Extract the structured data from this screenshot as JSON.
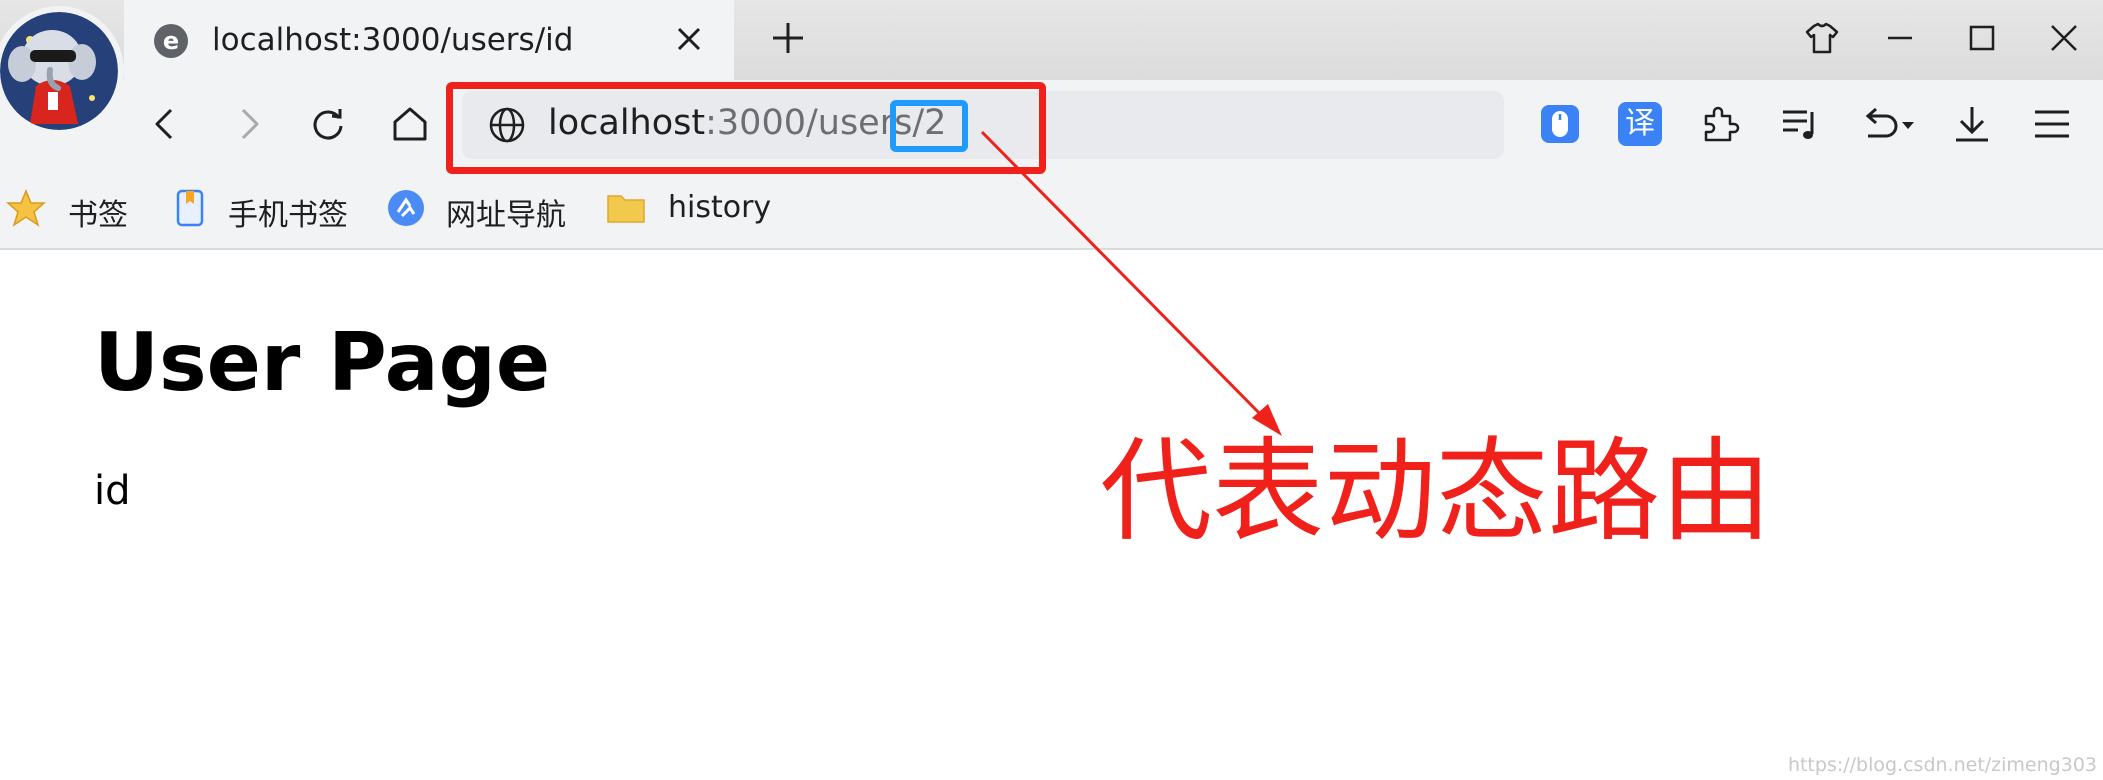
{
  "tab": {
    "favicon_glyph": "e",
    "title": "localhost:3000/users/id"
  },
  "omnibox": {
    "url_host": "localhost",
    "url_rest": ":3000/users/2"
  },
  "bookmarks": [
    {
      "icon": "star-icon",
      "label": "书签"
    },
    {
      "icon": "mobile-bookmark-icon",
      "label": "手机书签"
    },
    {
      "icon": "web-nav-icon",
      "label": "网址导航"
    },
    {
      "icon": "folder-icon",
      "label": "history"
    }
  ],
  "extensions": {
    "translate_glyph": "译"
  },
  "content": {
    "heading": "User Page",
    "text": "id"
  },
  "annotation": {
    "text": "代表动态路由",
    "color": "#f0201a",
    "highlight_color": "#1e9bff"
  },
  "watermark": "https://blog.csdn.net/zimeng303"
}
